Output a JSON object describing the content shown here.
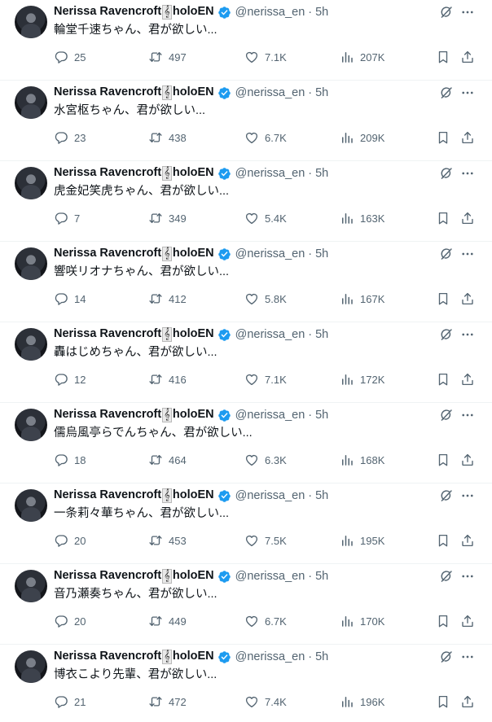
{
  "colors": {
    "text": "#0f1419",
    "muted": "#536471",
    "verified": "#1d9bf0",
    "divider": "#eff3f4"
  },
  "icons": {
    "avatar": "avatar",
    "verified": "verified-badge-icon",
    "grok": "grok-icon",
    "more": "more-icon",
    "reply": "reply-icon",
    "retweet": "retweet-icon",
    "like": "heart-icon",
    "views": "views-icon",
    "bookmark": "bookmark-icon",
    "share": "share-icon"
  },
  "tweets": [
    {
      "name_part1": "Nerissa Ravencroft",
      "name_clef": "𝄞",
      "name_part2": "holoEN",
      "handle": "@nerissa_en",
      "separator": "·",
      "time": "5h",
      "text": "輪堂千速ちゃん、君が欲しい...",
      "replies": "25",
      "retweets": "497",
      "likes": "7.1K",
      "views": "207K"
    },
    {
      "name_part1": "Nerissa Ravencroft",
      "name_clef": "𝄞",
      "name_part2": "holoEN",
      "handle": "@nerissa_en",
      "separator": "·",
      "time": "5h",
      "text": "水宮枢ちゃん、君が欲しい...",
      "replies": "23",
      "retweets": "438",
      "likes": "6.7K",
      "views": "209K"
    },
    {
      "name_part1": "Nerissa Ravencroft",
      "name_clef": "𝄞",
      "name_part2": "holoEN",
      "handle": "@nerissa_en",
      "separator": "·",
      "time": "5h",
      "text": "虎金妃笑虎ちゃん、君が欲しい...",
      "replies": "7",
      "retweets": "349",
      "likes": "5.4K",
      "views": "163K"
    },
    {
      "name_part1": "Nerissa Ravencroft",
      "name_clef": "𝄞",
      "name_part2": "holoEN",
      "handle": "@nerissa_en",
      "separator": "·",
      "time": "5h",
      "text": "響咲リオナちゃん、君が欲しい...",
      "replies": "14",
      "retweets": "412",
      "likes": "5.8K",
      "views": "167K"
    },
    {
      "name_part1": "Nerissa Ravencroft",
      "name_clef": "𝄞",
      "name_part2": "holoEN",
      "handle": "@nerissa_en",
      "separator": "·",
      "time": "5h",
      "text": "轟はじめちゃん、君が欲しい...",
      "replies": "12",
      "retweets": "416",
      "likes": "7.1K",
      "views": "172K"
    },
    {
      "name_part1": "Nerissa Ravencroft",
      "name_clef": "𝄞",
      "name_part2": "holoEN",
      "handle": "@nerissa_en",
      "separator": "·",
      "time": "5h",
      "text": "儒烏風亭らでんちゃん、君が欲しい...",
      "replies": "18",
      "retweets": "464",
      "likes": "6.3K",
      "views": "168K"
    },
    {
      "name_part1": "Nerissa Ravencroft",
      "name_clef": "𝄞",
      "name_part2": "holoEN",
      "handle": "@nerissa_en",
      "separator": "·",
      "time": "5h",
      "text": "一条莉々華ちゃん、君が欲しい...",
      "replies": "20",
      "retweets": "453",
      "likes": "7.5K",
      "views": "195K"
    },
    {
      "name_part1": "Nerissa Ravencroft",
      "name_clef": "𝄞",
      "name_part2": "holoEN",
      "handle": "@nerissa_en",
      "separator": "·",
      "time": "5h",
      "text": "音乃瀬奏ちゃん、君が欲しい...",
      "replies": "20",
      "retweets": "449",
      "likes": "6.7K",
      "views": "170K"
    },
    {
      "name_part1": "Nerissa Ravencroft",
      "name_clef": "𝄞",
      "name_part2": "holoEN",
      "handle": "@nerissa_en",
      "separator": "·",
      "time": "5h",
      "text": "博衣こより先輩、君が欲しい...",
      "replies": "21",
      "retweets": "472",
      "likes": "7.4K",
      "views": "196K"
    }
  ]
}
